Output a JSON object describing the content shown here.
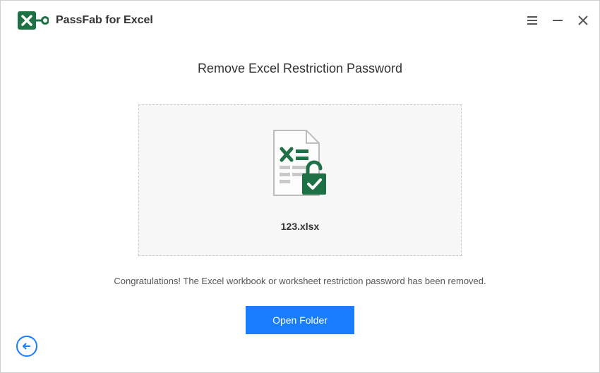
{
  "brand": {
    "name": "PassFab for Excel"
  },
  "page_title": "Remove Excel Restriction Password",
  "file": {
    "name": "123.xlsx"
  },
  "status_text": "Congratulations! The Excel workbook or worksheet restriction password has been removed.",
  "buttons": {
    "open_folder": "Open Folder"
  },
  "colors": {
    "primary": "#1a7cff",
    "brand_green": "#1e7145"
  }
}
